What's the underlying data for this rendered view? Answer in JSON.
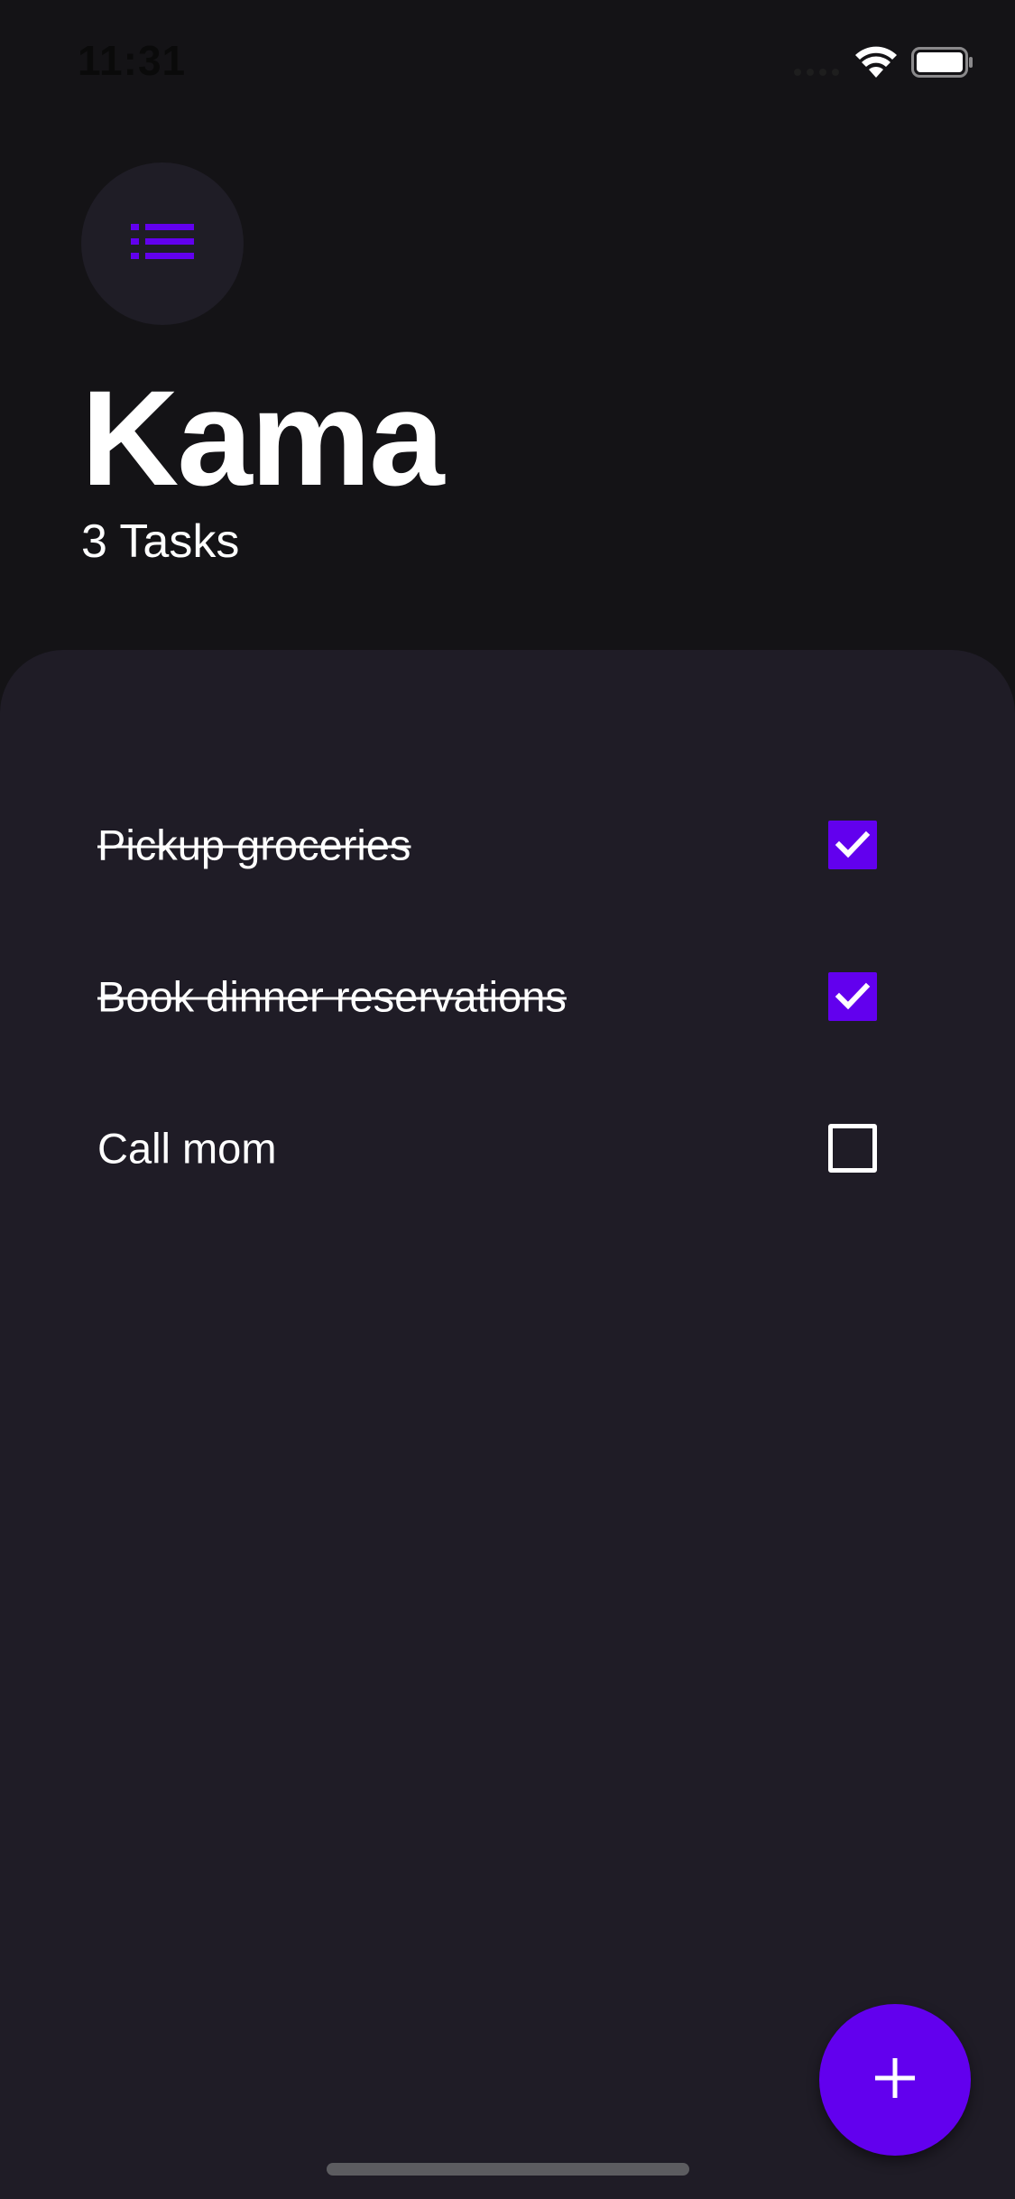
{
  "status_bar": {
    "time": "11:31",
    "icons": [
      "signal-icon",
      "wifi-icon",
      "battery-icon"
    ]
  },
  "header": {
    "menu_icon": "list-icon",
    "title": "Kama",
    "task_count": "3 Tasks"
  },
  "tasks": [
    {
      "label": "Pickup groceries",
      "completed": true
    },
    {
      "label": "Book dinner reservations",
      "completed": true
    },
    {
      "label": "Call mom",
      "completed": false
    }
  ],
  "fab": {
    "icon": "plus-icon"
  },
  "colors": {
    "background": "#141316",
    "sheet": "#1f1c26",
    "menu_button": "#1f1d26",
    "accent": "#6200ee",
    "text": "#ffffff"
  }
}
